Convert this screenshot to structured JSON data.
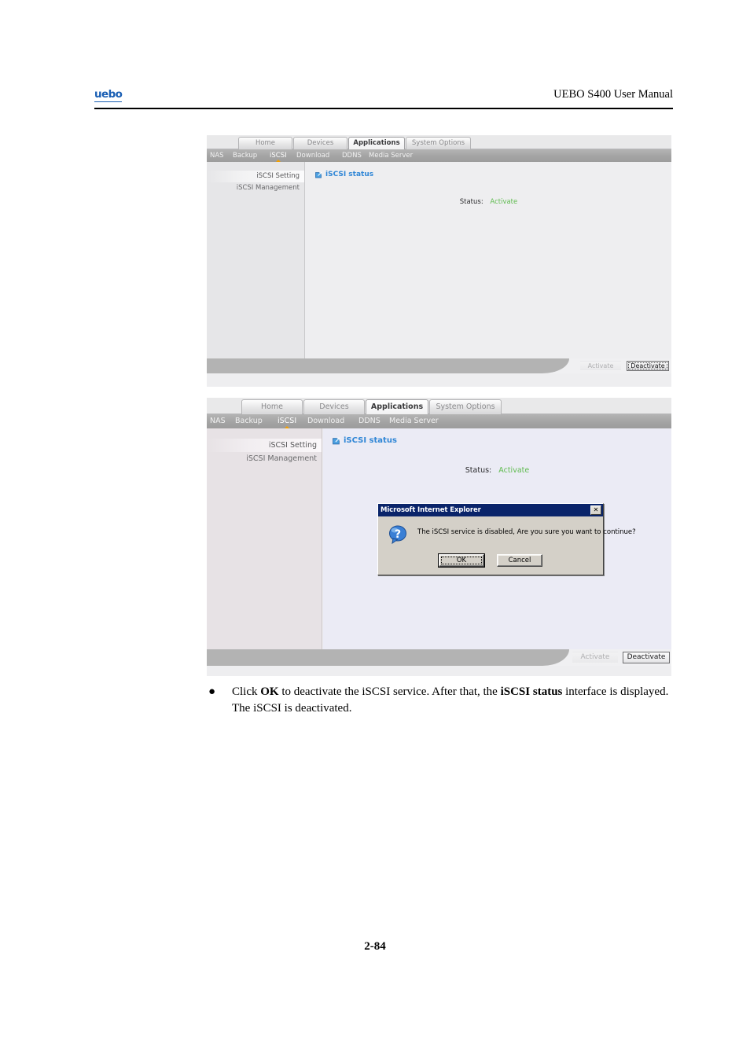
{
  "page": {
    "brand": "uebo",
    "header_title": "UEBO S400 User Manual",
    "page_number": "2-84"
  },
  "screenshot_top": {
    "tabs": [
      {
        "label": "Home",
        "active": false
      },
      {
        "label": "Devices",
        "active": false
      },
      {
        "label": "Applications",
        "active": true
      },
      {
        "label": "System Options",
        "active": false
      }
    ],
    "subnav": [
      {
        "label": "NAS",
        "active": false
      },
      {
        "label": "Backup",
        "active": false
      },
      {
        "label": "iSCSI",
        "active": true
      },
      {
        "label": "Download",
        "active": false
      },
      {
        "label": "DDNS",
        "active": false
      },
      {
        "label": "Media Server",
        "active": false
      }
    ],
    "sidebar": [
      {
        "label": "iSCSI Setting",
        "selected": true
      },
      {
        "label": "iSCSI Management",
        "selected": false
      }
    ],
    "content": {
      "heading": "iSCSI status",
      "heading_icon": "shortcut-link-icon",
      "status_label": "Status:",
      "status_value": "Activate"
    },
    "footer": {
      "activate_label": "Activate",
      "deactivate_label": "Deactivate"
    }
  },
  "screenshot_bottom": {
    "tabs": [
      {
        "label": "Home",
        "active": false
      },
      {
        "label": "Devices",
        "active": false
      },
      {
        "label": "Applications",
        "active": true
      },
      {
        "label": "System Options",
        "active": false
      }
    ],
    "subnav": [
      {
        "label": "NAS",
        "active": false
      },
      {
        "label": "Backup",
        "active": false
      },
      {
        "label": "iSCSI",
        "active": true
      },
      {
        "label": "Download",
        "active": false
      },
      {
        "label": "DDNS",
        "active": false
      },
      {
        "label": "Media Server",
        "active": false
      }
    ],
    "sidebar": [
      {
        "label": "iSCSI Setting",
        "selected": true
      },
      {
        "label": "iSCSI Management",
        "selected": false
      }
    ],
    "content": {
      "heading": "iSCSI status",
      "heading_icon": "shortcut-link-icon",
      "status_label": "Status:",
      "status_value": "Activate"
    },
    "footer": {
      "activate_label": "Activate",
      "deactivate_label": "Deactivate"
    },
    "dialog": {
      "title": "Microsoft Internet Explorer",
      "close_glyph": "✕",
      "icon": "question-mark-icon",
      "message": "The iSCSI service is disabled, Are you sure you want to continue?",
      "ok_label": "OK",
      "cancel_label": "Cancel"
    }
  },
  "body_copy": {
    "bullet_glyph": "●",
    "part1": "Click ",
    "bold1": "OK",
    "part2": " to deactivate the iSCSI service. After that, the ",
    "bold2": "iSCSI status",
    "part3": " interface is displayed. The iSCSI is deactivated."
  },
  "colors": {
    "brand_blue": "#1a5fb4",
    "heading_blue": "#2f86d6",
    "status_green": "#5fbb4f",
    "subnav_indicator": "#f4a000",
    "dialog_titlebar": "#0a246a"
  }
}
